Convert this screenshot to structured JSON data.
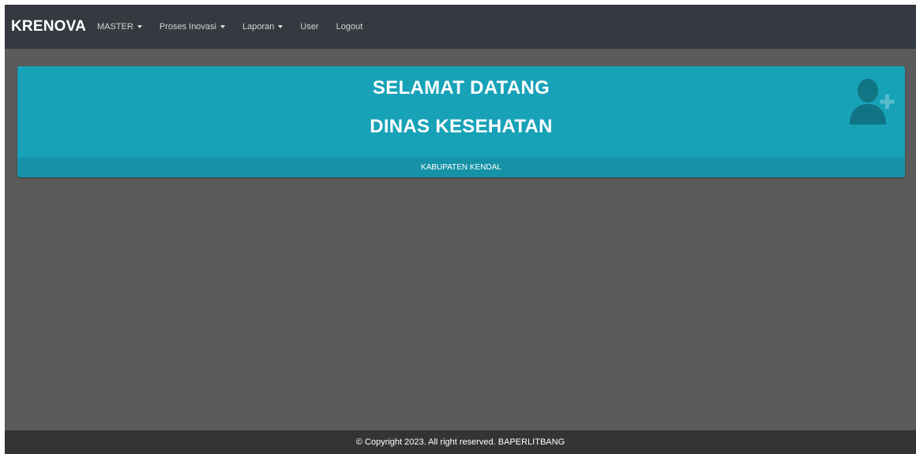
{
  "navbar": {
    "brand": "KRENOVA",
    "items": [
      {
        "label": "MASTER",
        "dropdown": true
      },
      {
        "label": "Proses Inovasi",
        "dropdown": true
      },
      {
        "label": "Laporan",
        "dropdown": true
      },
      {
        "label": "User",
        "dropdown": false
      },
      {
        "label": "Logout",
        "dropdown": false
      }
    ]
  },
  "welcome_card": {
    "title": "SELAMAT DATANG",
    "subtitle": "DINAS KESEHATAN",
    "footer": "KABUPATEN KENDAL",
    "icon": "user-plus-icon",
    "color": "#17a2b8"
  },
  "footer": {
    "text": "© Copyright 2023. All right reserved. BAPERLITBANG"
  }
}
